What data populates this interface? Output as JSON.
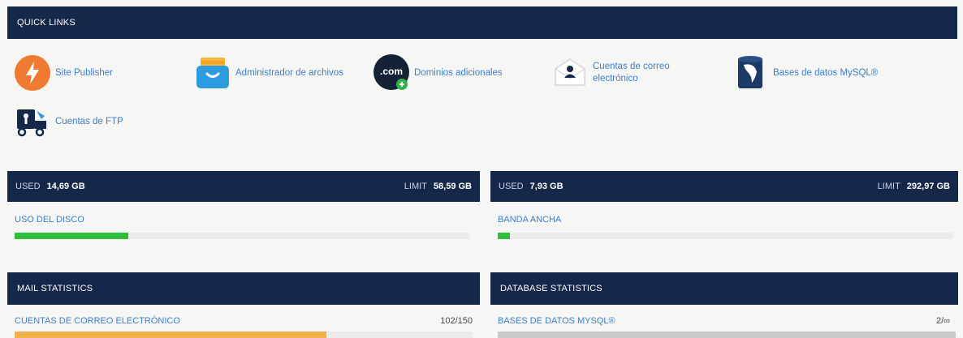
{
  "quick_links": {
    "title": "QUICK LINKS",
    "items": [
      {
        "label": "Site Publisher",
        "icon": "lightning-icon",
        "color": "#f07a32"
      },
      {
        "label": "Administrador de archivos",
        "icon": "folder-icon",
        "color": "#2c9be0"
      },
      {
        "label": "Dominios adicionales",
        "icon": "dotcom-icon",
        "color": "#142238",
        "icon_text": ".com"
      },
      {
        "label1": "Cuentas de correo",
        "label2": "electrónico",
        "icon": "envelope-user-icon",
        "color": "#16284a"
      },
      {
        "label": "Bases de datos MySQL®",
        "icon": "mysql-dolphin-icon",
        "color": "#1d3a66"
      },
      {
        "label": "Cuentas de FTP",
        "icon": "ftp-truck-icon",
        "color": "#16284a"
      }
    ]
  },
  "disk": {
    "used_label": "USED",
    "used_value": "14,69 GB",
    "limit_label": "LIMIT",
    "limit_value": "58,59 GB",
    "title": "USO DEL DISCO",
    "usage_fraction": 0.25,
    "color": "#2fbf3c"
  },
  "bandwidth": {
    "used_label": "USED",
    "used_value": "7,93 GB",
    "limit_label": "LIMIT",
    "limit_value": "292,97 GB",
    "title": "BANDA ANCHA",
    "usage_fraction": 0.027,
    "color": "#2fbf3c"
  },
  "mail_stats": {
    "title": "MAIL STATISTICS",
    "row_label": "CUENTAS DE CORREO ELECTRÓNICO",
    "count": "102/150",
    "usage_fraction": 0.68,
    "color": "#f0b24a"
  },
  "db_stats": {
    "title": "DATABASE STATISTICS",
    "row_label": "BASES DE DATOS MYSQL®",
    "count": "2/∞",
    "color": "#c9c9c9"
  }
}
